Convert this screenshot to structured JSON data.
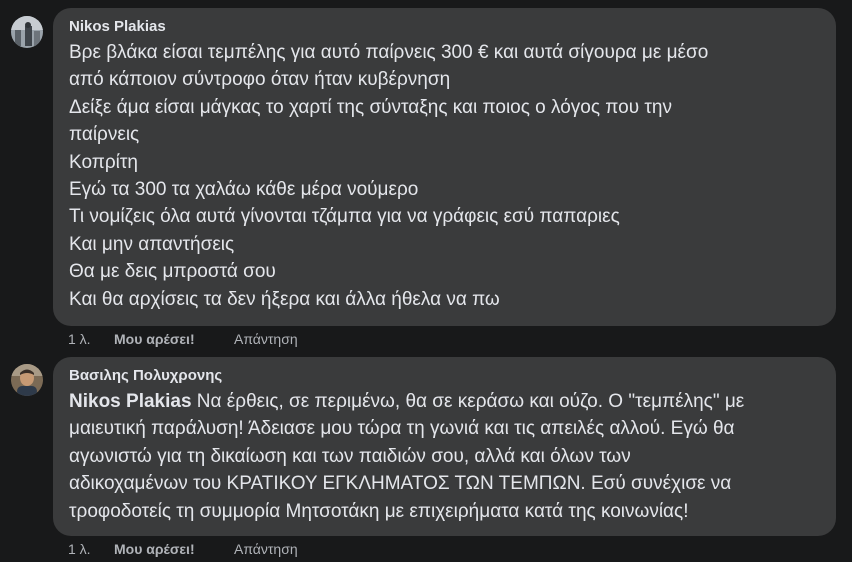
{
  "comments": [
    {
      "author": "Nikos Plakias",
      "lines": [
        "Βρε βλάκα είσαι τεμπέλης για αυτό παίρνεις 300 € και αυτά σίγουρα με μέσο",
        "από κάποιον σύντροφο όταν ήταν κυβέρνηση",
        "Δείξε άμα είσαι μάγκας το χαρτί της σύνταξης και ποιος ο λόγος που την",
        "παίρνεις",
        "Κοπρίτη",
        "Εγώ τα 300 τα χαλάω κάθε μέρα νούμερο",
        "Τι νομίζεις όλα αυτά γίνονται τζάμπα για να γράφεις εσύ παπαριες",
        "Και μην απαντήσεις",
        "Θα με δεις μπροστά σου",
        "Και θα αρχίσεις τα δεν ήξερα και άλλα ήθελα να πω"
      ],
      "time": "1 λ.",
      "like_label": "Μου αρέσει!",
      "reply_label": "Απάντηση"
    },
    {
      "author": "Βασιλης Πολυχρονης",
      "mention": "Nikos Plakias",
      "first_line_rest": " Να έρθεις, σε περιμένω, θα σε κεράσω και ούζο. Ο \"τεμπέλης\" με",
      "lines": [
        "μαιευτική παράλυση! Άδειασε μου τώρα τη γωνιά και τις απειλές αλλού. Εγώ θα",
        "αγωνιστώ για τη δικαίωση και των παιδιών σου, αλλά και όλων των",
        "αδικοχαμένων του ΚΡΑΤΙΚΟΥ ΕΓΚΛΗΜΑΤΟΣ ΤΩΝ ΤΕΜΠΩΝ. Εσύ συνέχισε να",
        "τροφοδοτείς τη συμμορία Μητσοτάκη με επιχειρήματα κατά της κοινωνίας!"
      ],
      "time": "1 λ.",
      "like_label": "Μου αρέσει!",
      "reply_label": "Απάντηση"
    }
  ],
  "colors": {
    "background": "#18191a",
    "bubble": "#3a3b3c",
    "text": "#e4e6eb",
    "secondary_text": "#b0b3b8"
  }
}
